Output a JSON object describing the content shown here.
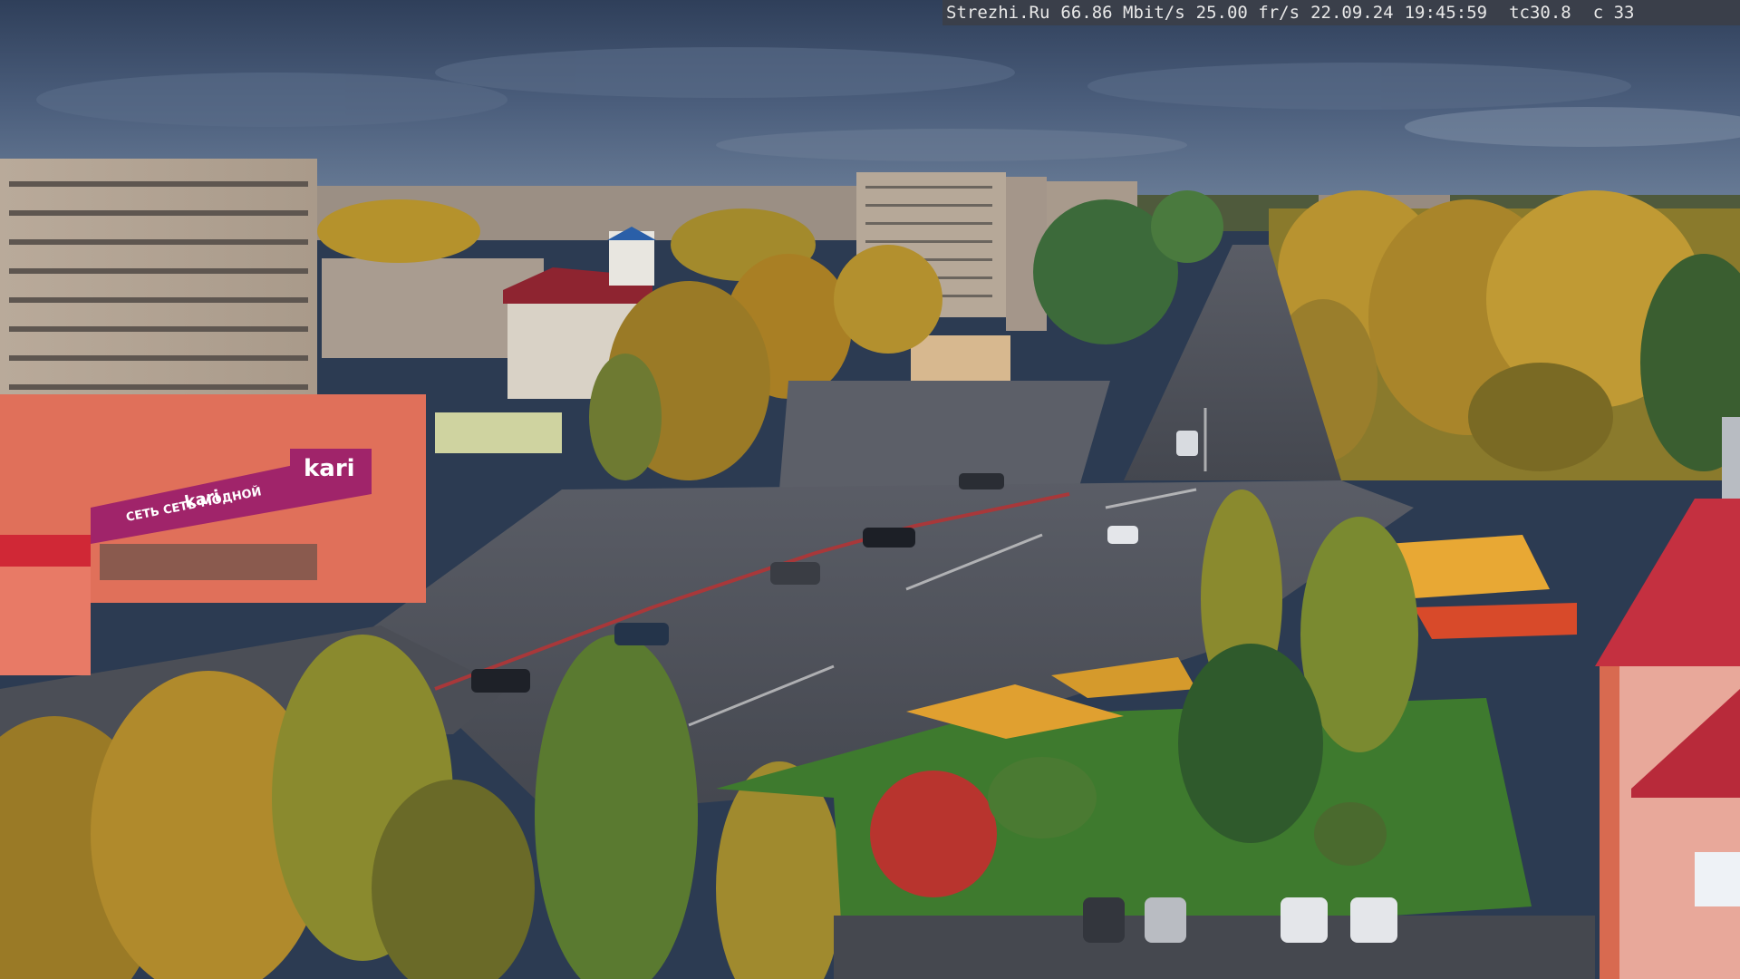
{
  "overlay": {
    "site": "Strezhi.Ru",
    "bitrate": "66.86 Mbit/s",
    "framerate": "25.00 fr/s",
    "date": "22.09.24",
    "time": "19:45:59",
    "tc": "tc30.8",
    "c": "c 33"
  },
  "signs": {
    "store_logo": "kari",
    "store_banner": "СЕТЬ СЕТЬ МОДНОЙ",
    "kari_small": "kari"
  },
  "colors": {
    "sky": "#3b4d69",
    "grass": "#3e7a2e",
    "road": "#4a4d55",
    "store_facade": "#e0705a",
    "banner": "#a0246a",
    "roof_red": "#c2303a",
    "flowers": "#e0a030"
  }
}
